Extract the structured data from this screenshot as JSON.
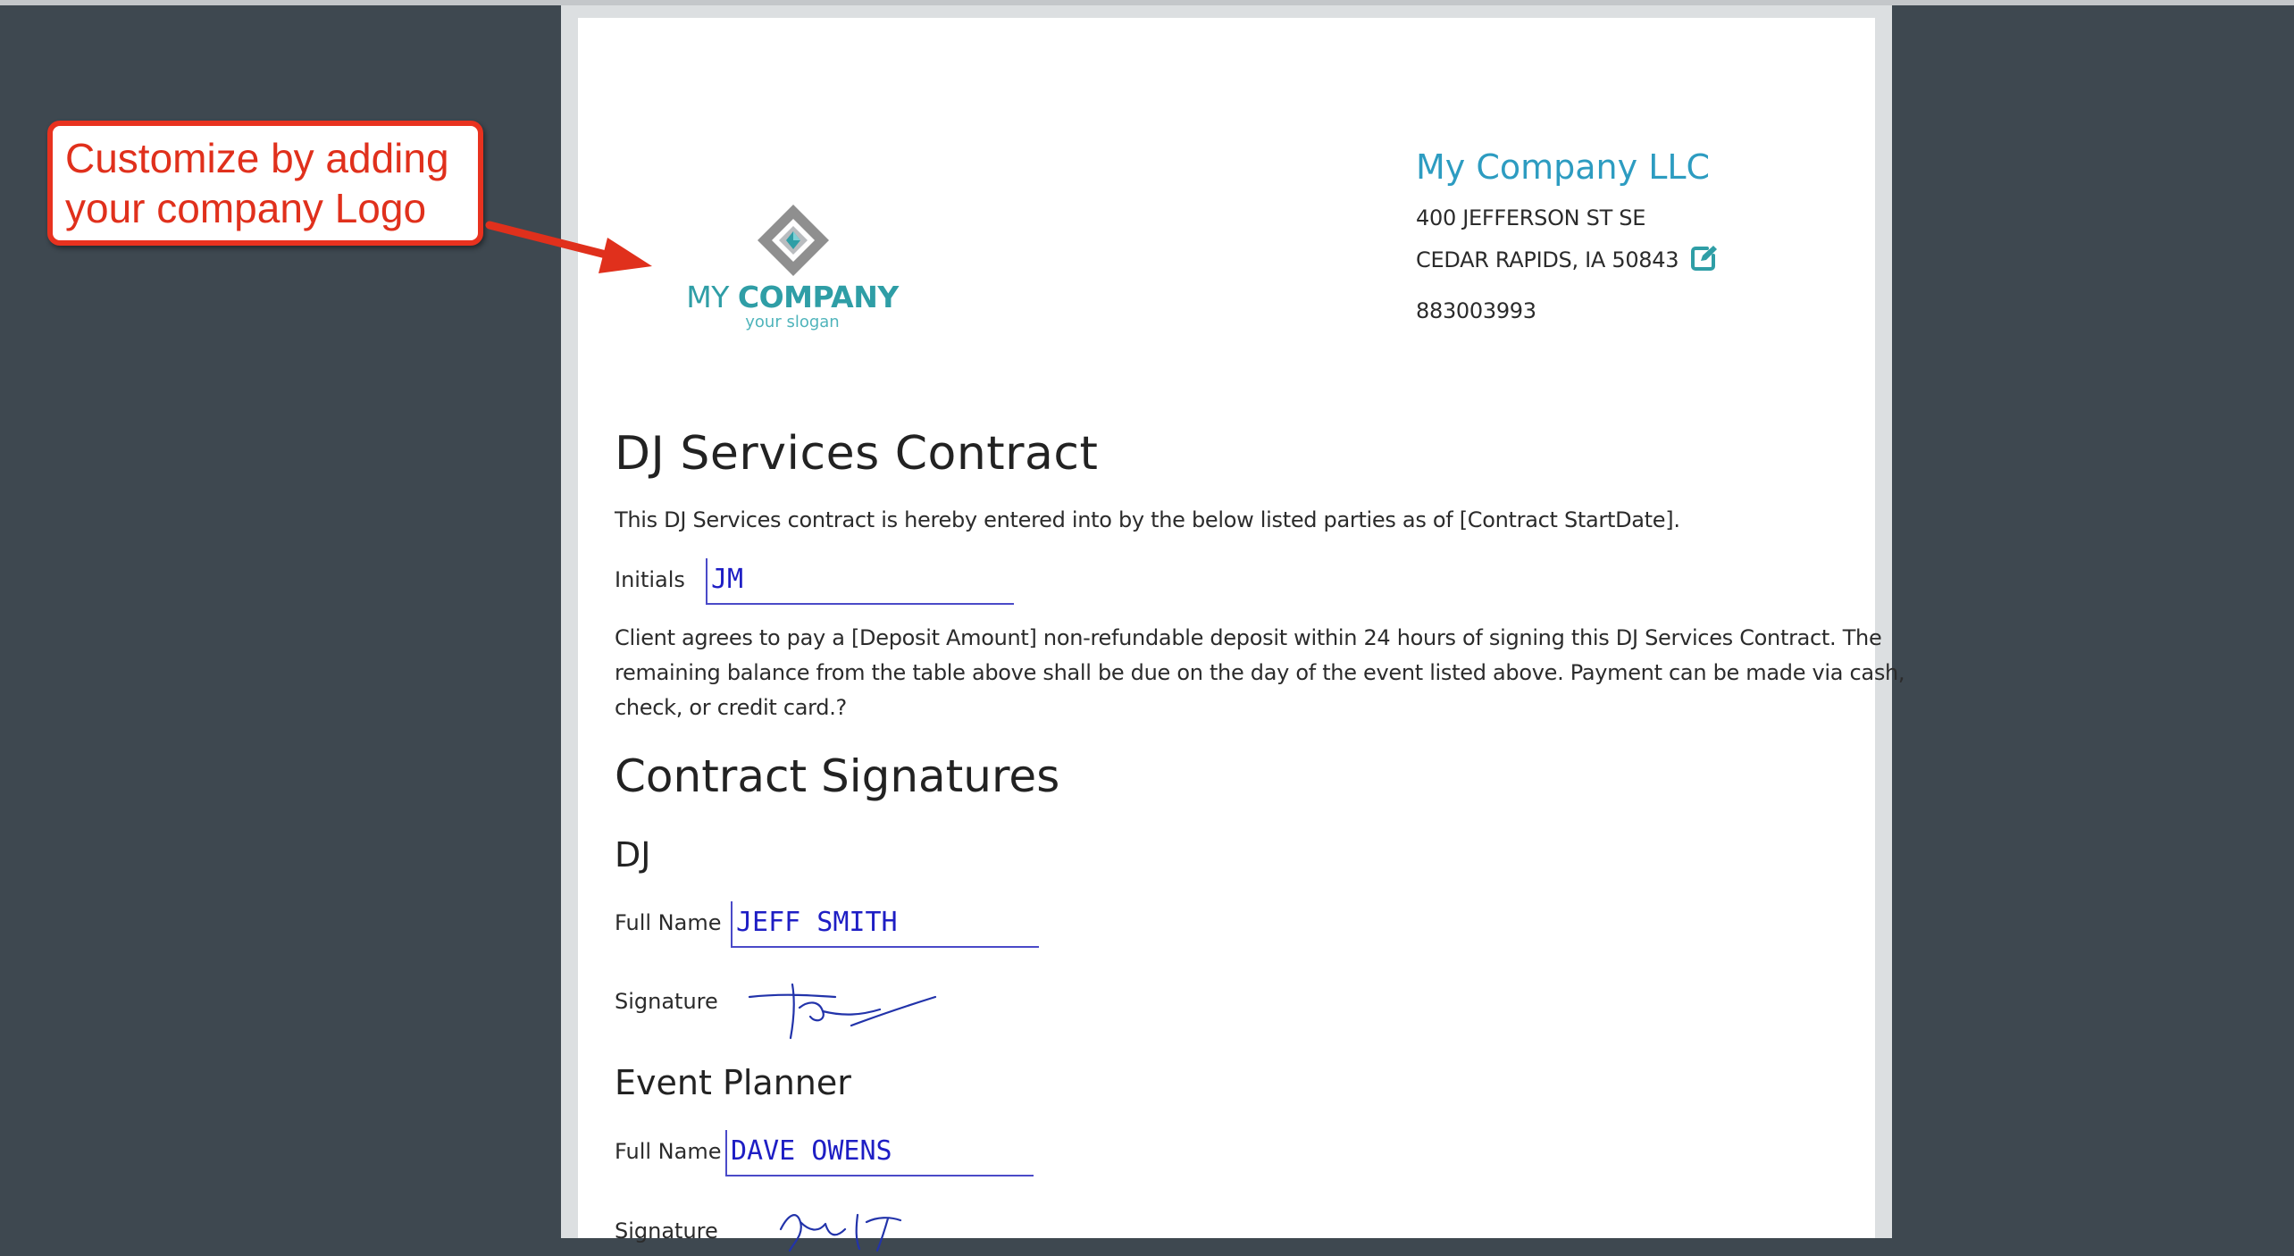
{
  "callout": {
    "line1": "Customize by adding",
    "line2": "your company Logo",
    "color": "#e0301c"
  },
  "logo": {
    "name_light": "MY ",
    "name_bold": "COMPANY",
    "slogan": "your slogan"
  },
  "company": {
    "name": "My Company LLC",
    "address_line1": "400 JEFFERSON ST SE",
    "address_line2": "CEDAR RAPIDS, IA 50843",
    "phone": "883003993",
    "edit_icon": "edit-icon"
  },
  "contract": {
    "title": "DJ Services Contract",
    "intro": "This DJ Services contract is hereby entered into by the below listed parties as of [Contract StartDate].",
    "initials_label": "Initials",
    "initials_value": "JM",
    "payment_lines": [
      "Client agrees to pay a [Deposit Amount] non-refundable deposit within 24 hours of signing this DJ Services Contract. The",
      "remaining balance from the table above shall be due on the day of the event listed above. Payment can be made via cash,",
      "check, or credit card.?"
    ]
  },
  "signatures": {
    "heading": "Contract Signatures",
    "dj": {
      "heading": "DJ",
      "full_name_label": "Full Name",
      "full_name_value": "JEFF SMITH",
      "signature_label": "Signature"
    },
    "planner": {
      "heading": "Event Planner",
      "full_name_label": "Full Name",
      "full_name_value": "DAVE OWENS",
      "signature_label": "Signature"
    }
  },
  "colors": {
    "background": "#3e4850",
    "brand_teal": "#2f9ea6",
    "company_blue": "#2d9cc1",
    "ink_blue": "#1e1ec4"
  }
}
